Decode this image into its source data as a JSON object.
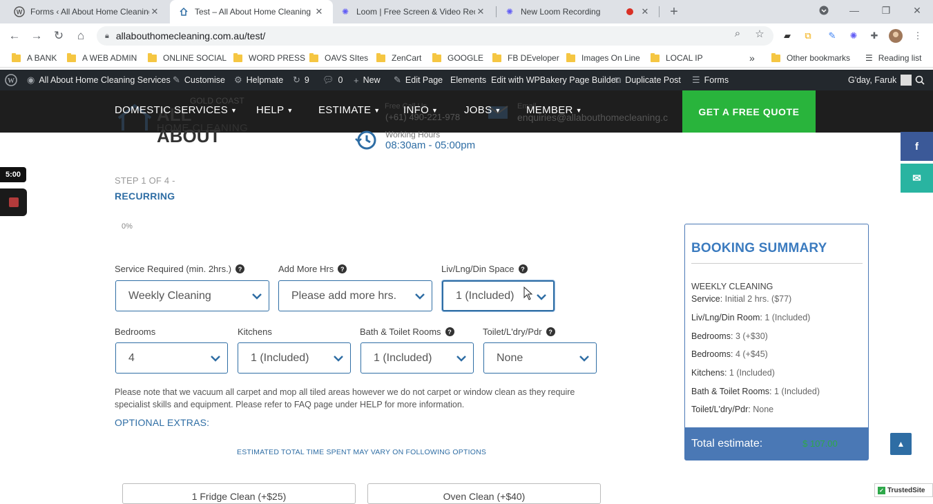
{
  "browser": {
    "tabs": [
      {
        "title": "Forms ‹ All About Home Cleaning"
      },
      {
        "title": "Test – All About Home Cleaning"
      },
      {
        "title": "Loom | Free Screen & Video Rec"
      },
      {
        "title": "New Loom Recording"
      }
    ],
    "new_tab": "+",
    "url": "allabouthomecleaning.com.au/test/",
    "bookmarks": [
      "A BANK",
      "A WEB ADMIN",
      "ONLINE SOCIAL",
      "WORD PRESS",
      "OAVS SItes",
      "ZenCart",
      "GOOGLE",
      "FB DEveloper",
      "Images On Line",
      "LOCAL IP"
    ],
    "more_bookmarks": "»",
    "other_bookmarks": "Other bookmarks",
    "reading_list": "Reading list"
  },
  "wp_admin": {
    "site_name": "All About Home Cleaning Services",
    "customise": "Customise",
    "helpmate": "Helpmate",
    "updates_count": "9",
    "comments_count": "0",
    "new": "New",
    "edit_page": "Edit Page",
    "elements": "Elements",
    "wpbakery": "Edit with WPBakery Page Builder",
    "duplicate": "Duplicate Post",
    "forms": "Forms",
    "greeting": "G'day, Faruk"
  },
  "header": {
    "logo_line1": "GOLD COAST",
    "logo_line2": "ALL ABOUT",
    "logo_line3": "HOME CLEANING",
    "menu": [
      "DOMESTIC SERVICES",
      "HELP",
      "ESTIMATE",
      "INFO",
      "JOBS",
      "MEMBER"
    ],
    "phone_label": "Free Call Us",
    "phone": "(+61) 490-221-978",
    "email_label": "Email",
    "email": "enquiries@allabouthomecleaning.c",
    "quote_button": "GET A FREE QUOTE",
    "hours_label": "Working Hours",
    "hours_value": "08:30am - 05:00pm"
  },
  "social": {
    "facebook": "f",
    "email": "✉"
  },
  "loom": {
    "timer": "5:00"
  },
  "form": {
    "step_label": "STEP 1 OF 4 -",
    "step_name": "RECURRING",
    "progress": "0%",
    "service_label": "Service Required (min. 2hrs.)",
    "service_value": "Weekly Cleaning",
    "hours_label": "Add More Hrs",
    "hours_value": "Please add more hrs.",
    "living_label": "Liv/Lng/Din Space",
    "living_value": "1 (Included)",
    "bedrooms_label": "Bedrooms",
    "bedrooms_value": "4",
    "kitchens_label": "Kitchens",
    "kitchens_value": "1 (Included)",
    "bath_label": "Bath & Toilet Rooms",
    "bath_value": "1 (Included)",
    "toilet_label": "Toilet/L'dry/Pdr",
    "toilet_value": "None",
    "note": "Please note that we vacuum all carpet and mop all tiled areas however we do not carpet or window clean as they require specialist skills and equipment. Please refer to FAQ page under HELP for more information.",
    "optional_title": "OPTIONAL EXTRAS:",
    "estimate_note": "ESTIMATED TOTAL TIME SPENT MAY VARY ON FOLLOWING OPTIONS",
    "extras": [
      "1 Fridge Clean (+$25)",
      "Oven Clean (+$40)"
    ]
  },
  "summary": {
    "title": "BOOKING SUMMARY",
    "plan": "WEEKLY CLEANING",
    "rows": [
      {
        "label": "Service",
        "value": "Initial 2 hrs. ($77)"
      },
      {
        "label": "Liv/Lng/Din Room",
        "value": "1 (Included)"
      },
      {
        "label": "Bedrooms",
        "value": "3 (+$30)"
      },
      {
        "label": "Bedrooms",
        "value": "4 (+$45)"
      },
      {
        "label": "Kitchens",
        "value": "1 (Included)"
      },
      {
        "label": "Bath & Toilet Rooms",
        "value": "1 (Included)"
      },
      {
        "label": "Toilet/L'dry/Pdr",
        "value": "None"
      }
    ],
    "total_label": "Total estimate:",
    "total_value": "$ 107.00"
  },
  "trusted": "TrustedSite",
  "colors": {
    "brand_blue": "#2e6da4",
    "quote_green": "#29b43c",
    "header_dark": "#1e1e1e",
    "wp_bar": "#23282d"
  }
}
